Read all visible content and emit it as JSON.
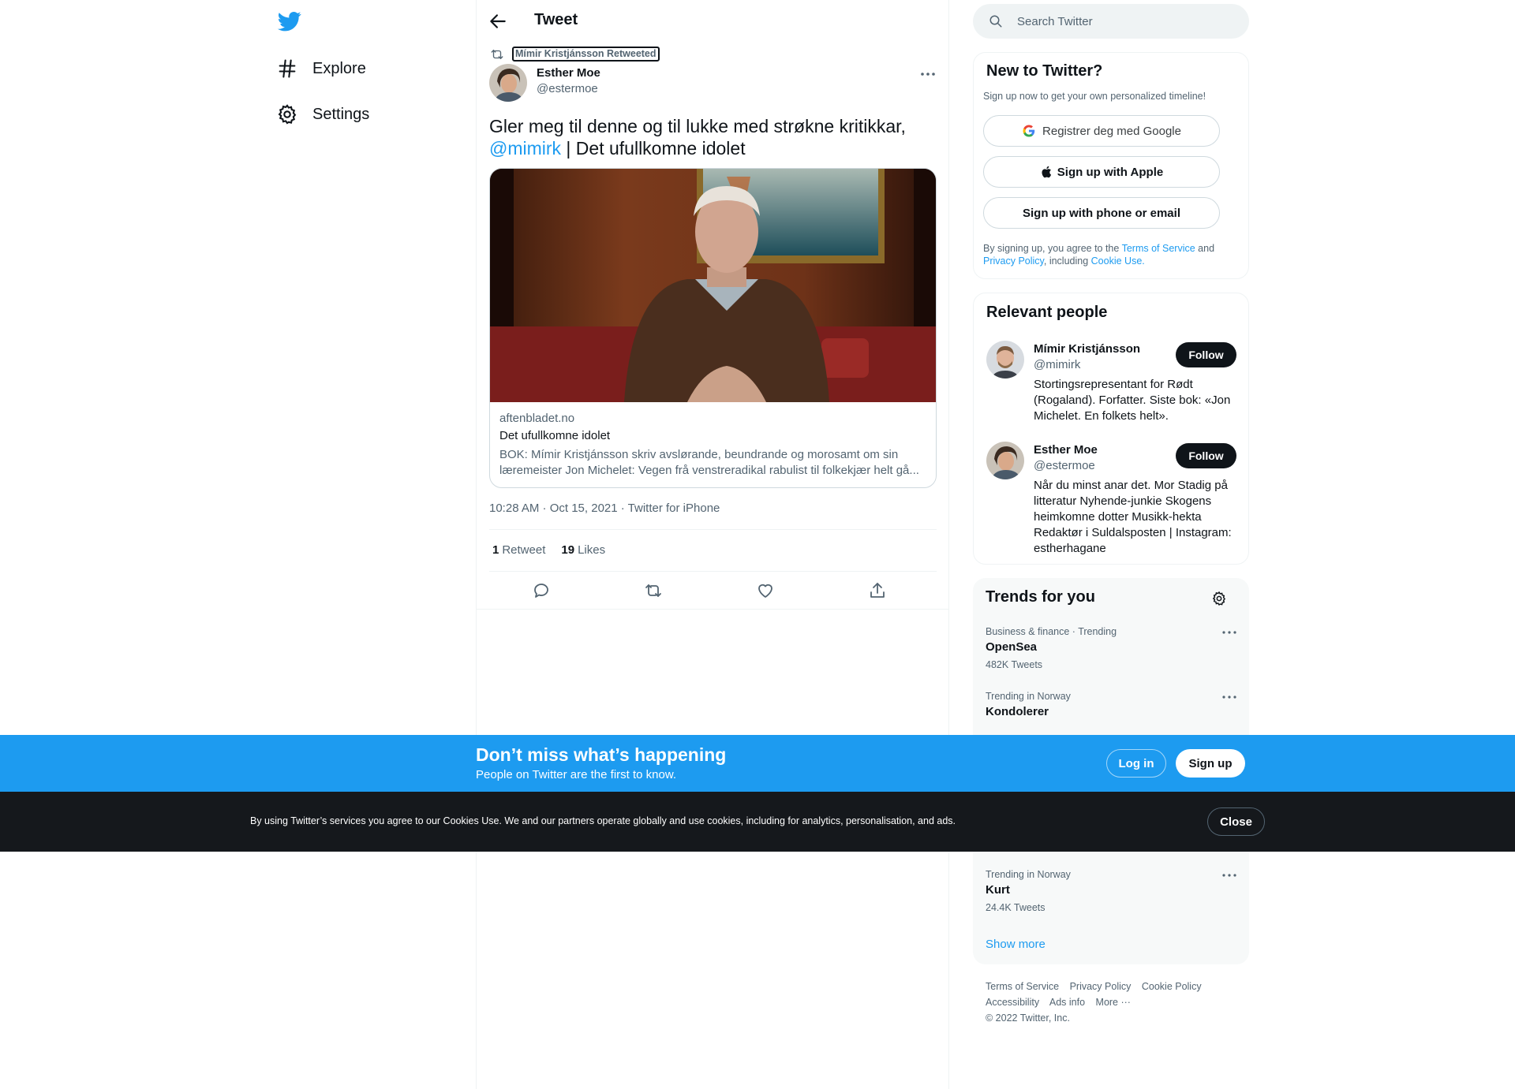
{
  "nav": {
    "items": [
      {
        "label": "Explore",
        "icon": "hashtag-icon"
      },
      {
        "label": "Settings",
        "icon": "gear-icon"
      }
    ]
  },
  "header": {
    "title": "Tweet"
  },
  "tweet": {
    "retweeted_by": "Mímir Kristjánsson Retweeted",
    "author_name": "Esther Moe",
    "author_handle": "@estermoe",
    "text_part1": "Gler meg til denne og til lukke med strøkne kritikkar,",
    "mention": "@mimirk",
    "text_part2": " | Det ufullkomne idolet",
    "card": {
      "domain": "aftenbladet.no",
      "title": "Det ufullkomne idolet",
      "description": "BOK: Mímir Kristjánsson skriv avslørande, beundrande og morosamt om sin læremeister Jon Michelet: Vegen frå venstreradikal rabulist til folkekjær helt gå..."
    },
    "timestamp": "10:28 AM · Oct 15, 2021 · Twitter for iPhone",
    "retweets_count": "1",
    "retweets_label": "Retweet",
    "likes_count": "19",
    "likes_label": "Likes"
  },
  "search": {
    "placeholder": "Search Twitter"
  },
  "new_to_twitter": {
    "title": "New to Twitter?",
    "subtitle": "Sign up now to get your own personalized timeline!",
    "google_label": "Registrer deg med Google",
    "apple_label": "Sign up with Apple",
    "phone_label": "Sign up with phone or email",
    "legal_prefix": "By signing up, you agree to the",
    "terms": "Terms of Service",
    "and": "and",
    "privacy": "Privacy Policy",
    "including": ", including",
    "cookie": "Cookie Use."
  },
  "relevant_people": {
    "title": "Relevant people",
    "people": [
      {
        "name": "Mímir Kristjánsson",
        "handle": "@mimirk",
        "bio": "Stortingsrepresentant for Rødt (Rogaland). Forfatter. Siste bok: «Jon Michelet. En folkets helt».",
        "follow": "Follow"
      },
      {
        "name": "Esther Moe",
        "handle": "@estermoe",
        "bio": "Når du minst anar det. Mor Stadig på litteratur Nyhende-junkie Skogens heimkomne dotter Musikk-hekta Redaktør i Suldalsposten | Instagram: estherhagane",
        "follow": "Follow"
      }
    ]
  },
  "trends": {
    "title": "Trends for you",
    "items": [
      {
        "meta": "Business & finance · Trending",
        "name": "OpenSea",
        "count": "482K Tweets"
      },
      {
        "meta": "Trending in Norway",
        "name": "Kondolerer",
        "count": ""
      },
      {
        "meta": "Trending in Norway",
        "name": "Kurt",
        "count": "24.4K Tweets"
      }
    ],
    "show_more": "Show more"
  },
  "footer": {
    "links": [
      "Terms of Service",
      "Privacy Policy",
      "Cookie Policy",
      "Accessibility",
      "Ads info",
      "More ···"
    ],
    "copyright": "© 2022 Twitter, Inc."
  },
  "signup_bar": {
    "title": "Don’t miss what’s happening",
    "subtitle": "People on Twitter are the first to know.",
    "login": "Log in",
    "signup": "Sign up"
  },
  "cookie_bar": {
    "text": "By using Twitter’s services you agree to our Cookies Use. We and our partners operate globally and use cookies, including for analytics, personalisation, and ads.",
    "close": "Close"
  },
  "colors": {
    "accent": "#1d9bf0",
    "text": "#0f1419",
    "muted": "#536471",
    "dark_bar": "#15181c"
  }
}
